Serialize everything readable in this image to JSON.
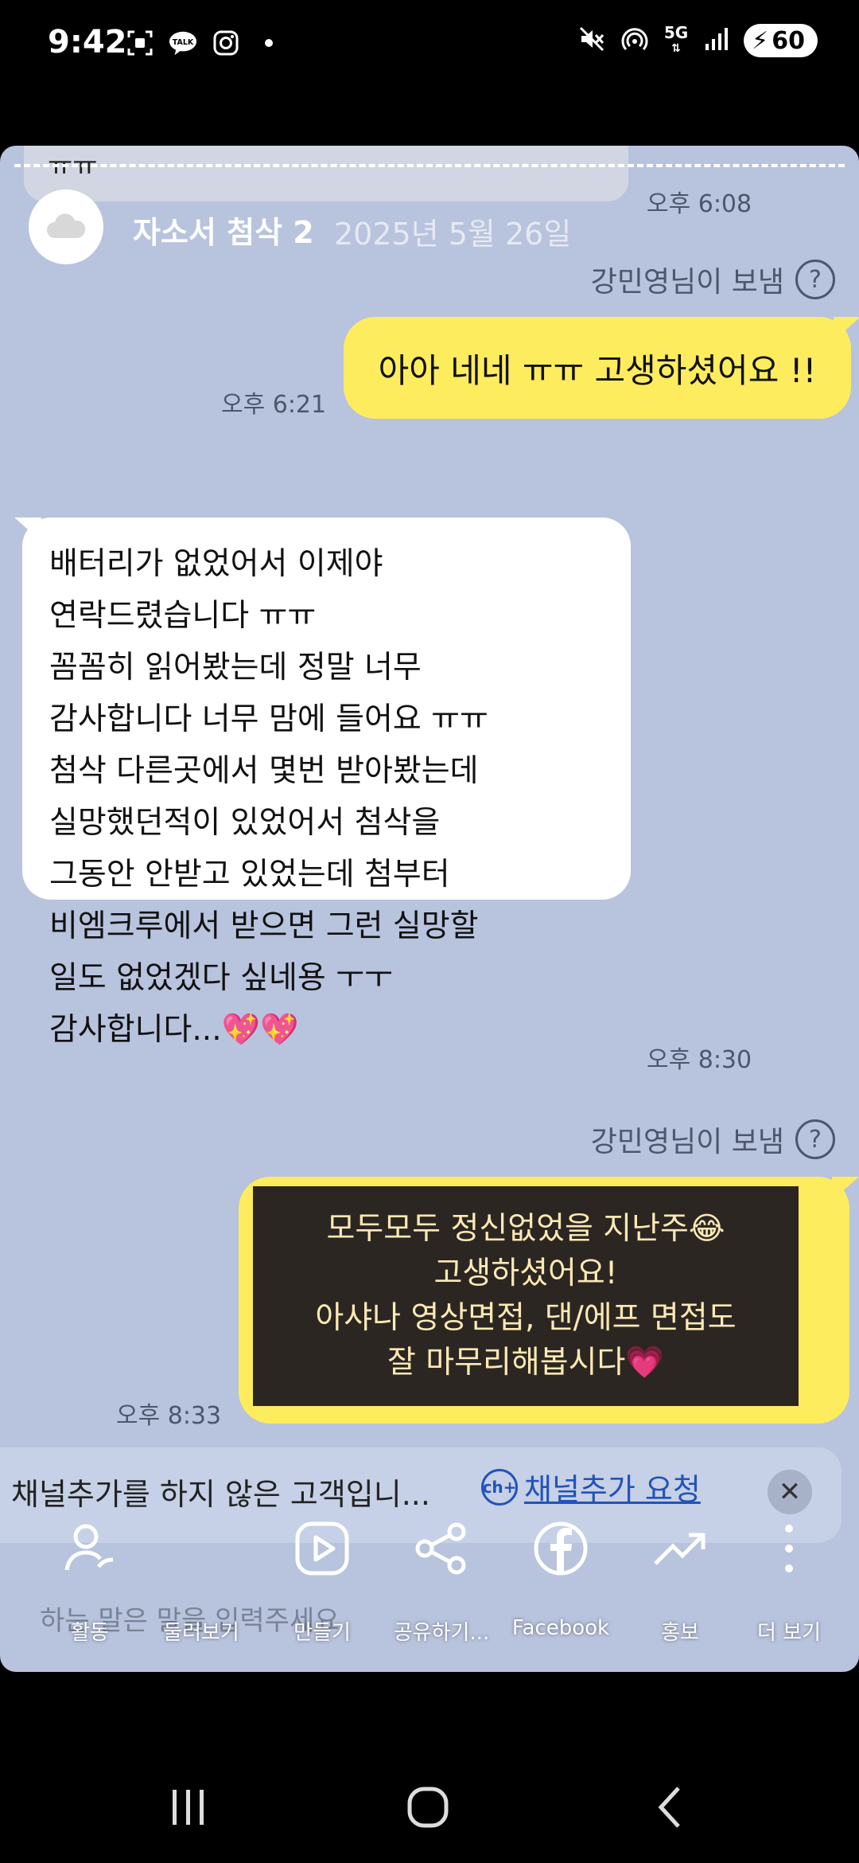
{
  "status_bar": {
    "time": "9:42",
    "left_icons": [
      "screenshot-icon",
      "kakaotalk-icon",
      "instagram-icon",
      "notification-dot-icon"
    ],
    "right_icons": [
      "mute-icon",
      "hotspot-icon",
      "5g-icon",
      "signal-icon"
    ],
    "network": "5G",
    "battery": "60"
  },
  "chat": {
    "clipped_text": "ㅠㅠ",
    "room_title": "자소서 첨삭 2",
    "room_date": "2025년 5월 26일",
    "timestamps": {
      "t1": "오후 6:08",
      "t2": "오후 6:21",
      "t3": "오후 8:30",
      "t4": "오후 8:33"
    },
    "sent_by": "강민영님이 보냄",
    "message_1": "아아 네네 ㅠㅠ 고생하셨어요 !!",
    "message_2_lines": [
      "배터리가 없었어서 이제야",
      "연락드렸습니다 ㅠㅠ",
      "꼼꼼히 읽어봤는데 정말 너무",
      "감사합니다 너무 맘에 들어요 ㅠㅠ",
      "첨삭 다른곳에서 몇번 받아봤는데",
      "실망했던적이 있었어서  첨삭을",
      "그동안 안받고 있었는데 첨부터",
      "비엠크루에서 받으면 그런 실망할",
      "일도 없었겠다 싶네용 ㅜㅜ",
      "감사합니다...💖💖"
    ],
    "message_3_lines": [
      "모두모두 정신없었을 지난주😂",
      "고생하셨어요!",
      "아샤나 영상면접, 댄/에프 면접도",
      "잘 마무리해봅시다💗"
    ],
    "channel_notice": "채널추가를 하지 않은 고객입니...",
    "channel_badge": "ch+",
    "channel_request": "채널추가 요청",
    "input_placeholder_faded": "하는 말은 말을 입력주세요"
  },
  "actions": [
    {
      "label": "활동",
      "icon": "person-activity-icon"
    },
    {
      "label": "둘러보기",
      "icon": "none"
    },
    {
      "label": "만들기",
      "icon": "play-icon"
    },
    {
      "label": "공유하기...",
      "icon": "share-icon"
    },
    {
      "label": "Facebook",
      "icon": "facebook-icon"
    },
    {
      "label": "홍보",
      "icon": "trending-icon"
    },
    {
      "label": "더 보기",
      "icon": "more-vertical-icon"
    }
  ],
  "nav": [
    "recents-icon",
    "home-icon",
    "back-icon"
  ],
  "colors": {
    "chat_bg": "#b8c3de",
    "yellow_bubble": "#fdec5e",
    "dark_box": "#2c2623",
    "link": "#2253b8"
  }
}
